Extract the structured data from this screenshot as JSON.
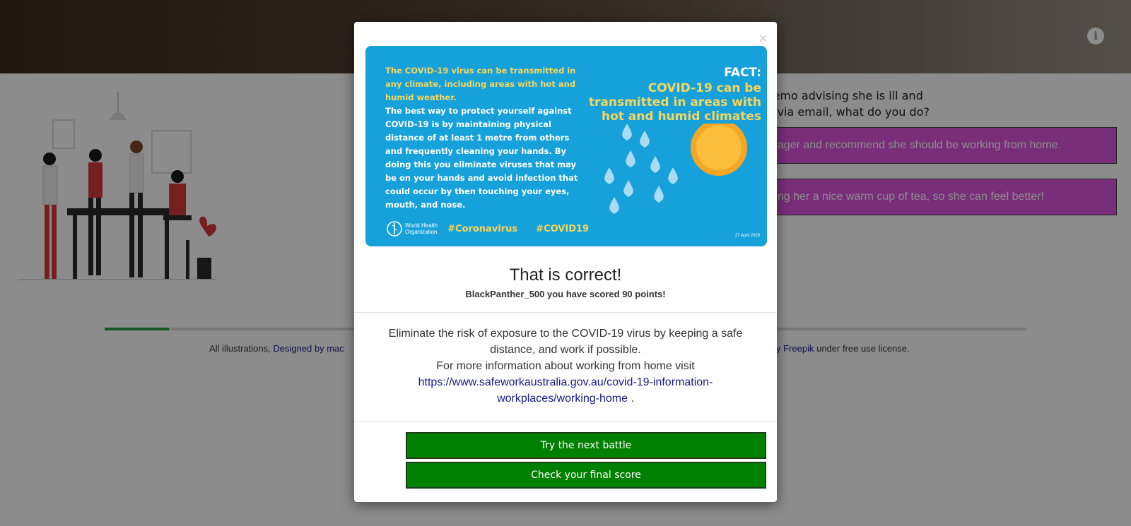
{
  "header": {
    "info_icon": "info-circle-icon"
  },
  "question": {
    "text_line1": "memo advising she is ill and",
    "text_line2": "er via email, what do you do?",
    "answers": [
      {
        "label": "nager and recommend she should be working from home."
      },
      {
        "label": "ring her a nice warm cup of tea, so she can feel better!"
      }
    ]
  },
  "progress": {
    "fraction": 0.07
  },
  "credits": {
    "prefix": "All illustrations,",
    "link1": "Designed by mac",
    "link2": "y Freepik",
    "suffix": "under free use license."
  },
  "modal": {
    "close": "×",
    "poster": {
      "body_yellow": "The COVID-19 virus can be transmitted in any climate, including areas with hot and humid weather.",
      "body_white": "The best way to protect yourself against COVID-19 is by maintaining physical distance of at least 1 metre from others and frequently cleaning your hands. By doing this you eliminate viruses that may be on your hands and avoid infection that could occur by then touching your eyes, mouth, and nose.",
      "fact_label": "FACT:",
      "fact_headline": "COVID-19 can be transmitted in areas with hot and humid climates",
      "org_line1": "World Health",
      "org_line2": "Organization",
      "hashtag1": "#Coronavirus",
      "hashtag2": "#COVID19",
      "date": "27 April 2020"
    },
    "title": "That is correct!",
    "score": "BlackPanther_500 you have scored 90 points!",
    "message_line1": "Eliminate the risk of exposure to the COVID-19 virus by keeping a safe distance, and work if possible.",
    "message_line2": "For more information about working from home visit",
    "message_link": "https://www.safeworkaustralia.gov.au/covid-19-information-workplaces/working-home",
    "message_end": ".",
    "next_button": "Try the next battle",
    "final_button": "Check your final score"
  },
  "colors": {
    "accent_green": "#008000",
    "answer_purple": "#dd55dd",
    "poster_blue": "#17a1db"
  }
}
